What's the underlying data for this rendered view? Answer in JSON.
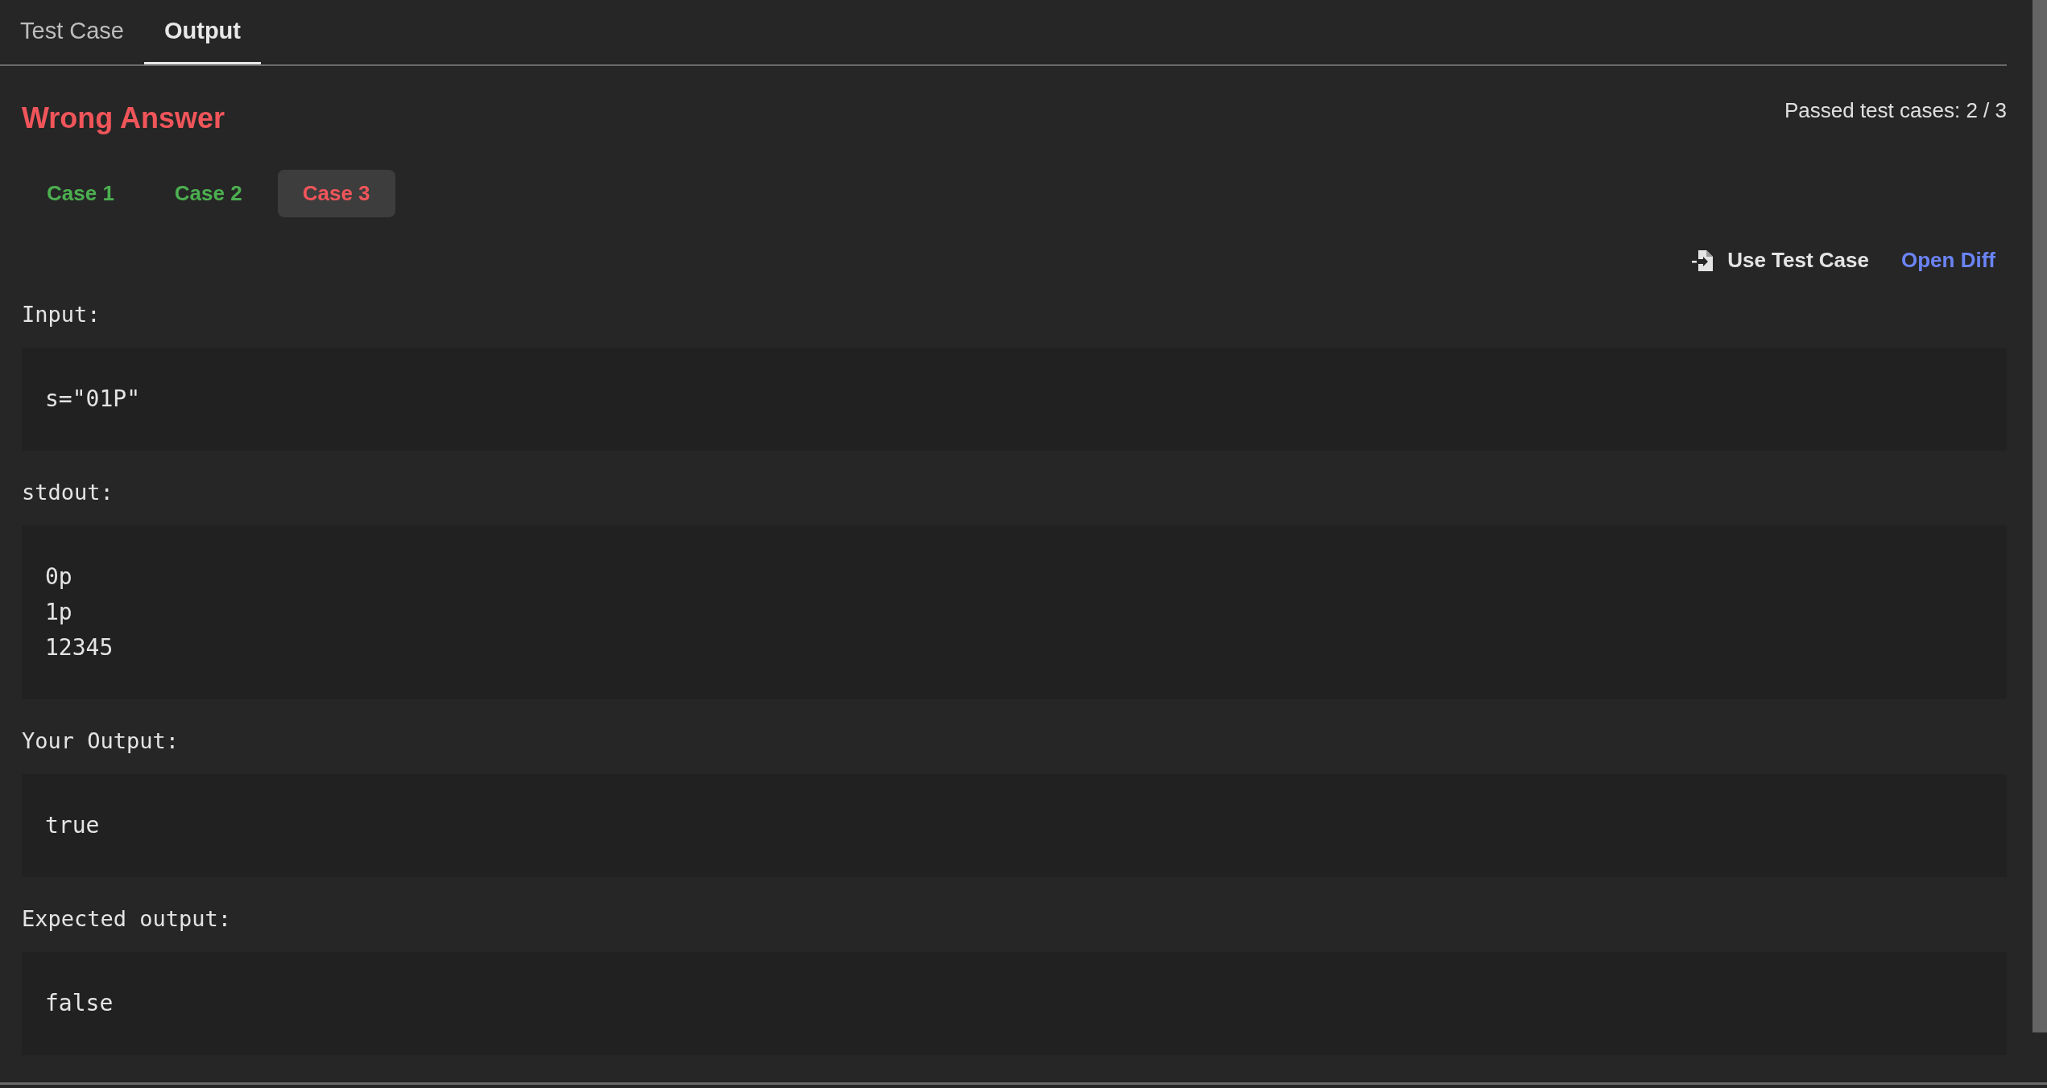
{
  "tabs": [
    {
      "label": "Test Case",
      "selected": false
    },
    {
      "label": "Output",
      "selected": true
    }
  ],
  "verdict": "Wrong Answer",
  "passed_summary": "Passed test cases: 2 / 3",
  "cases": [
    {
      "label": "Case 1",
      "passed": true,
      "selected": false
    },
    {
      "label": "Case 2",
      "passed": true,
      "selected": false
    },
    {
      "label": "Case 3",
      "passed": false,
      "selected": true
    }
  ],
  "actions": [
    {
      "label": "Use Test Case",
      "kind": "button"
    },
    {
      "label": "Open Diff",
      "kind": "link"
    }
  ],
  "sections": [
    {
      "label": "Input:",
      "lines": [
        "s=\"01P\""
      ]
    },
    {
      "label": "stdout:",
      "lines": [
        "0p",
        "1p",
        "12345"
      ]
    },
    {
      "label": "Your Output:",
      "lines": [
        "true"
      ]
    },
    {
      "label": "Expected output:",
      "lines": [
        "false"
      ]
    }
  ]
}
